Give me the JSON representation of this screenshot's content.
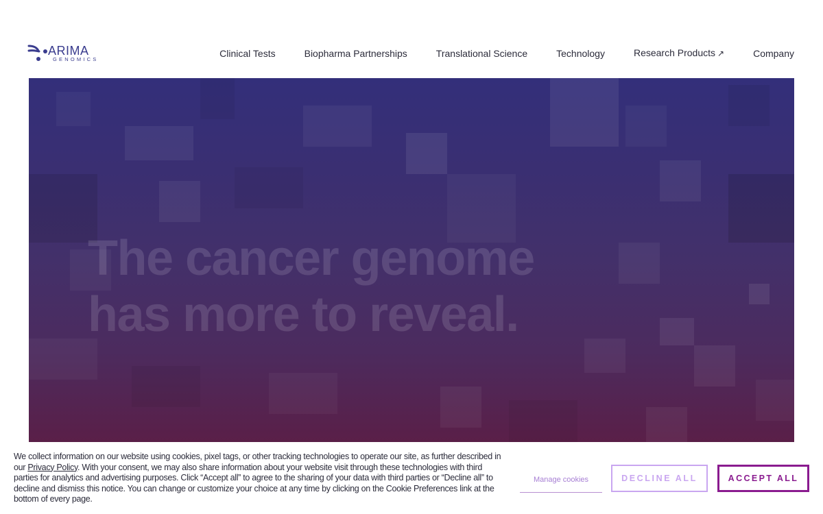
{
  "brand": {
    "name": "ARIMA",
    "subtitle": "GENOMICS",
    "color": "#3a3c8e"
  },
  "nav": {
    "items": [
      {
        "label": "Clinical Tests"
      },
      {
        "label": "Biopharma Partnerships"
      },
      {
        "label": "Translational Science"
      },
      {
        "label": "Technology"
      },
      {
        "label": "Research Products"
      },
      {
        "label": "Company"
      }
    ],
    "external_icon": "↗"
  },
  "hero": {
    "title_line1": "The cancer genome",
    "title_line2": "has more to reveal.",
    "gradient_top": "#332f7a",
    "gradient_bottom": "#5a1f48"
  },
  "cookie_banner": {
    "text_before_link": "We collect information on our website using cookies, pixel tags, or other tracking technologies to operate our site, as further described in our ",
    "privacy_link": "Privacy Policy",
    "text_after_link": ". With your consent, we may also share information about your website visit through these technologies with third parties for analytics and advertising purposes. Click “Accept all” to agree to the sharing of your data with third parties or “Decline all” to decline and dismiss this notice. You can change or customize your choice at any time by clicking on the Cookie Preferences link at the bottom of every page.",
    "manage_label": "Manage cookies",
    "decline_label": "DECLINE ALL",
    "accept_label": "ACCEPT ALL",
    "accent_color": "#8a1b8f"
  }
}
